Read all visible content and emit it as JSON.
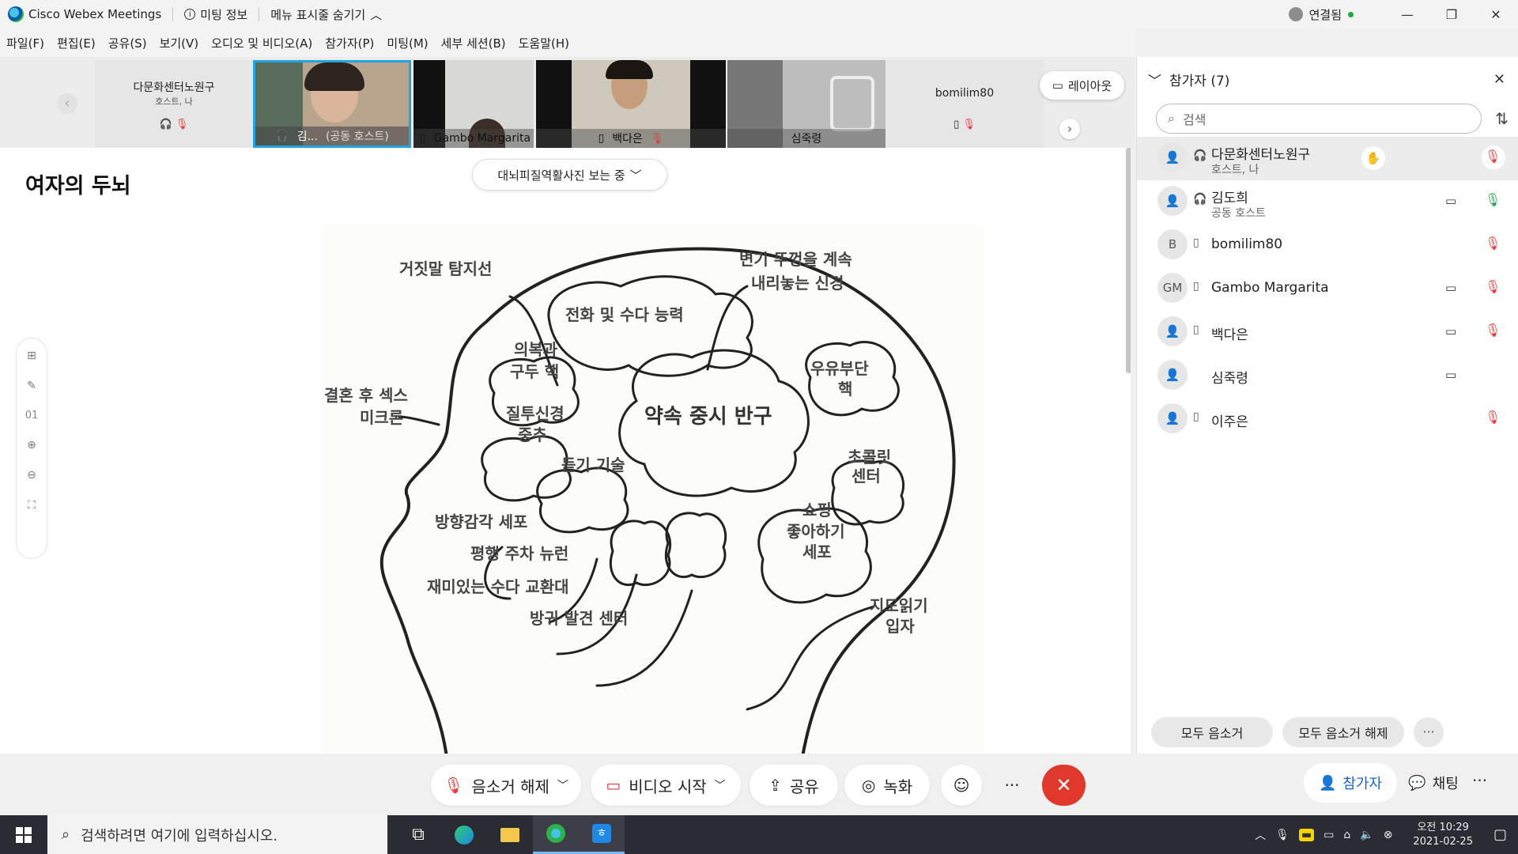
{
  "titlebar": {
    "app_name": "Cisco Webex Meetings",
    "meeting_info": "미팅 정보",
    "hide_menu": "메뉴 표시줄 숨기기",
    "connection_status": "연결됨"
  },
  "menubar": [
    "파일(F)",
    "편집(E)",
    "공유(S)",
    "보기(V)",
    "오디오 및 비디오(A)",
    "참가자(P)",
    "미팅(M)",
    "세부 세션(B)",
    "도움말(H)"
  ],
  "video_strip": {
    "tiles": [
      {
        "name": "다문화센터노원구",
        "sub": "호스트, 나"
      },
      {
        "name": "김...",
        "sub": "(공동 호스트)"
      },
      {
        "name": "Gambo Margarita"
      },
      {
        "name": "백다은"
      },
      {
        "name": "심죽령"
      },
      {
        "name": "bomilim80"
      }
    ],
    "layout_label": "레이아웃"
  },
  "content": {
    "slide_title": "여자의 두뇌",
    "viewing_label": "대뇌피질역활사진 보는 중",
    "page_number": "01",
    "diagram_labels": {
      "lie_detector": "거짓말 탐지선",
      "toilet_seat_1": "변기 뚜껑을 계속",
      "toilet_seat_2": "내리놓는 신경",
      "phone_talk": "전화 및 수다 능력",
      "clothes_1": "의복과",
      "clothes_2": "구두 핵",
      "milk_1": "우유부단",
      "milk_2": "핵",
      "marriage_1": "결혼 후 섹스",
      "marriage_2": "미크론",
      "jealousy_1": "질투신경",
      "jealousy_2": "중추",
      "promise": "약속 중시 반구",
      "listening": "듣기 기술",
      "chocolate_1": "초콜릿",
      "chocolate_2": "센터",
      "shopping_1": "쇼핑",
      "shopping_2": "좋아하기",
      "shopping_3": "세포",
      "direction": "방향감각 세포",
      "parking": "평행 주차 뉴런",
      "fun_talk": "재미있는 수다 교환대",
      "cockroach": "방귀 발견 센터",
      "map_1": "지도읽기",
      "map_2": "입자"
    }
  },
  "participants_panel": {
    "title": "참가자 (7)",
    "search_placeholder": "검색",
    "participants": [
      {
        "name": "다문화센터노원구",
        "role": "호스트, 나",
        "avatar": "",
        "mic": "muted",
        "hand": true,
        "camera": false
      },
      {
        "name": "김도희",
        "role": "공동 호스트",
        "avatar": "",
        "mic": "active",
        "hand": false,
        "camera": true
      },
      {
        "name": "bomilim80",
        "role": "",
        "avatar": "B",
        "mic": "muted",
        "hand": false,
        "camera": false
      },
      {
        "name": "Gambo Margarita",
        "role": "",
        "avatar": "GM",
        "mic": "muted",
        "hand": false,
        "camera": true
      },
      {
        "name": "백다은",
        "role": "",
        "avatar": "",
        "mic": "muted",
        "hand": false,
        "camera": true
      },
      {
        "name": "심죽령",
        "role": "",
        "avatar": "",
        "mic": "none",
        "hand": false,
        "camera": true
      },
      {
        "name": "이주은",
        "role": "",
        "avatar": "",
        "mic": "muted",
        "hand": false,
        "camera": false
      }
    ],
    "mute_all": "모두 음소거",
    "unmute_all": "모두 음소거 해제"
  },
  "controls": {
    "unmute": "음소거 해제",
    "start_video": "비디오 시작",
    "share": "공유",
    "record": "녹화",
    "participants_tab": "참가자",
    "chat_tab": "채팅"
  },
  "taskbar": {
    "search_placeholder": "검색하려면 여기에 입력하십시오.",
    "time_period": "오전 10:29",
    "date": "2021-02-25"
  },
  "colors": {
    "accent_blue": "#1a63c5",
    "end_red": "#e0392b",
    "mute_red": "#e5383b",
    "active_green": "#1ba84c",
    "tile_highlight": "#1fa5e0"
  }
}
